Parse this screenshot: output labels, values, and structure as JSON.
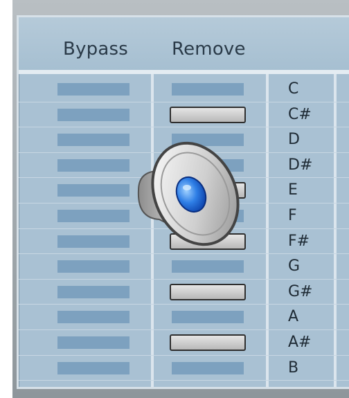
{
  "header": {
    "bypass_label": "Bypass",
    "remove_label": "Remove"
  },
  "rows": [
    {
      "note": "C",
      "remove_active": false
    },
    {
      "note": "C#",
      "remove_active": true
    },
    {
      "note": "D",
      "remove_active": false
    },
    {
      "note": "D#",
      "remove_active": false
    },
    {
      "note": "E",
      "remove_active": true
    },
    {
      "note": "F",
      "remove_active": false
    },
    {
      "note": "F#",
      "remove_active": true
    },
    {
      "note": "G",
      "remove_active": false
    },
    {
      "note": "G#",
      "remove_active": true
    },
    {
      "note": "A",
      "remove_active": false
    },
    {
      "note": "A#",
      "remove_active": true
    },
    {
      "note": "B",
      "remove_active": false
    }
  ],
  "overlay": {
    "icon": "speaker-icon"
  },
  "colors": {
    "panel": "#a9c1d3",
    "bar": "#7da1bf",
    "button": "#d0d0d0"
  }
}
